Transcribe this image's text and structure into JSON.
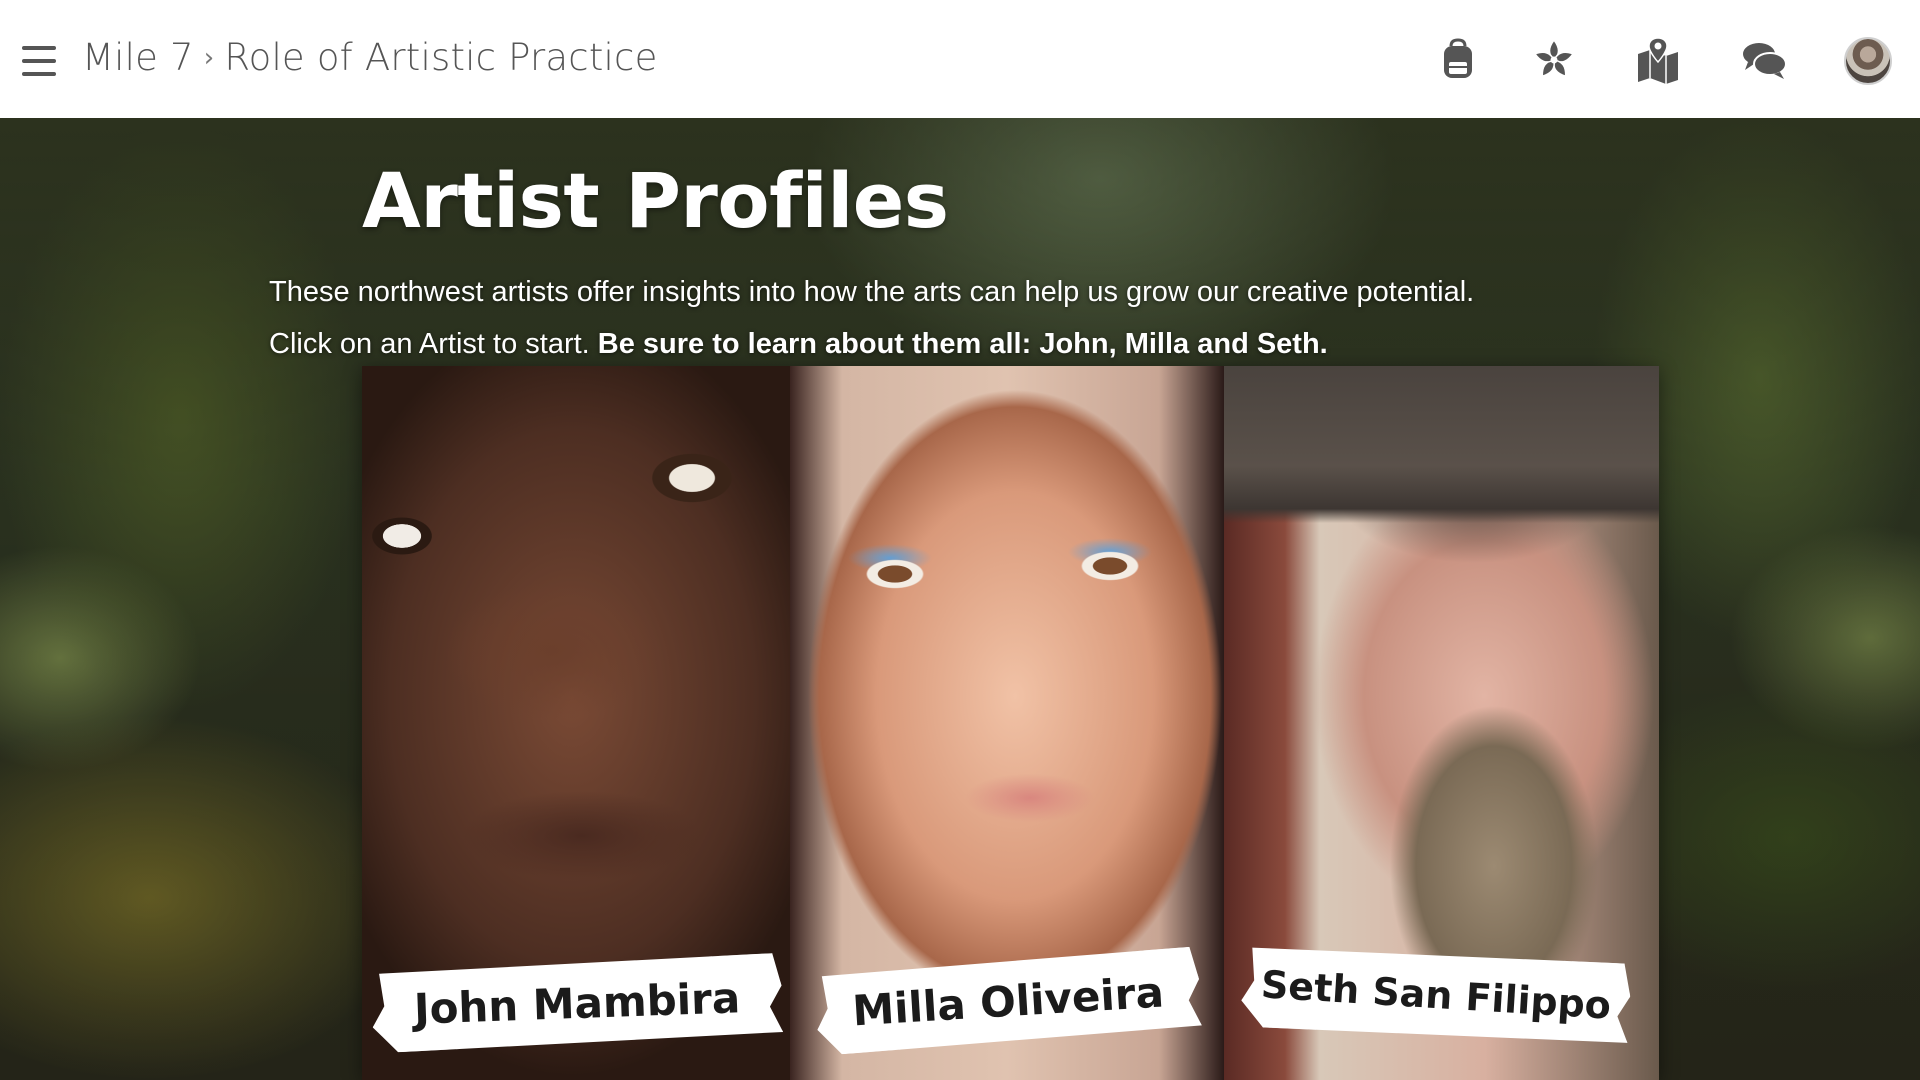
{
  "header": {
    "menu_icon": "hamburger-menu-icon",
    "breadcrumb": {
      "parent": "Mile 7",
      "separator": "›",
      "current": "Role of Artistic Practice"
    },
    "nav_icons": [
      "backpack-icon",
      "flower-icon",
      "map-icon",
      "chat-icon"
    ],
    "avatar_icon": "user-avatar"
  },
  "hero": {
    "title": "Artist Profiles",
    "description": "These northwest artists offer insights into how the arts can help us grow our creative potential.",
    "instruction": "Click on an Artist to start.",
    "instruction_bold": "Be sure to learn about them all: John, Milla and Seth."
  },
  "artists": [
    {
      "name": "John Mambira"
    },
    {
      "name": "Milla Oliveira"
    },
    {
      "name": "Seth San Filippo"
    }
  ],
  "colors": {
    "topbar_bg": "#ffffff",
    "icon_gray": "#555555",
    "hero_text": "#ffffff",
    "name_tag_bg": "#ffffff",
    "name_tag_text": "#1b1b1b"
  }
}
